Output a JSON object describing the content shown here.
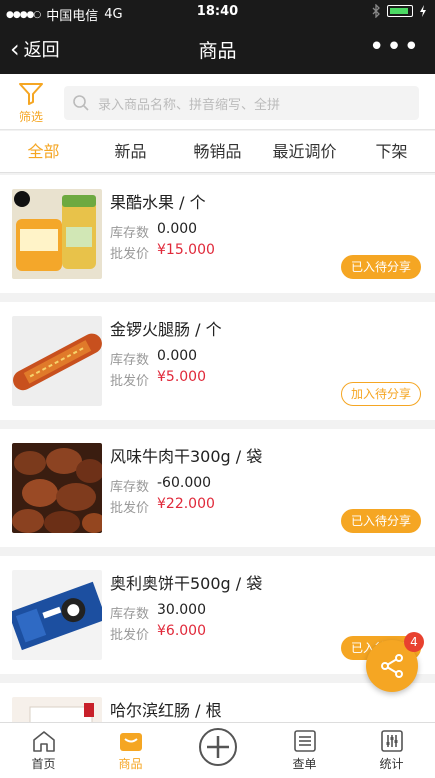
{
  "status_bar": {
    "carrier": "中国电信",
    "network": "4G",
    "time": "18:40"
  },
  "nav": {
    "back_label": "返回",
    "title": "商品",
    "more_label": "•••"
  },
  "search": {
    "filter_label": "筛选",
    "placeholder": "录入商品名称、拼音缩写、全拼"
  },
  "tabs": [
    {
      "label": "全部",
      "active": true
    },
    {
      "label": "新品"
    },
    {
      "label": "畅销品"
    },
    {
      "label": "最近调价"
    },
    {
      "label": "下架"
    }
  ],
  "products": [
    {
      "name": "果酷水果 / 个",
      "stock_label": "库存数",
      "stock": "0.000",
      "price_label": "批发价",
      "price": "¥15.000",
      "action": "已入待分享",
      "action_state": "added",
      "image": "fruit-jar"
    },
    {
      "name": "金锣火腿肠 / 个",
      "stock_label": "库存数",
      "stock": "0.000",
      "price_label": "批发价",
      "price": "¥5.000",
      "action": "加入待分享",
      "action_state": "add",
      "image": "ham-sausage"
    },
    {
      "name": "风味牛肉干300g / 袋",
      "stock_label": "库存数",
      "stock": "-60.000",
      "price_label": "批发价",
      "price": "¥22.000",
      "action": "已入待分享",
      "action_state": "added",
      "image": "beef-jerky"
    },
    {
      "name": "奥利奥饼干500g / 袋",
      "stock_label": "库存数",
      "stock": "30.000",
      "price_label": "批发价",
      "price": "¥6.000",
      "action": "已入待分享",
      "action_state": "added",
      "image": "oreo-pack"
    },
    {
      "name": "哈尔滨红肠 / 根",
      "image": "red-sausage"
    }
  ],
  "share_fab": {
    "badge": "4"
  },
  "bottom_nav": [
    {
      "label": "首页",
      "icon": "home-icon"
    },
    {
      "label": "商品",
      "icon": "box-icon",
      "active": true
    },
    {
      "label": "",
      "icon": "plus-circle-icon"
    },
    {
      "label": "查单",
      "icon": "order-list-icon"
    },
    {
      "label": "统计",
      "icon": "stats-icon"
    }
  ],
  "colors": {
    "accent": "#f5a623",
    "price": "#e0293a",
    "header": "#1a1a1a"
  }
}
